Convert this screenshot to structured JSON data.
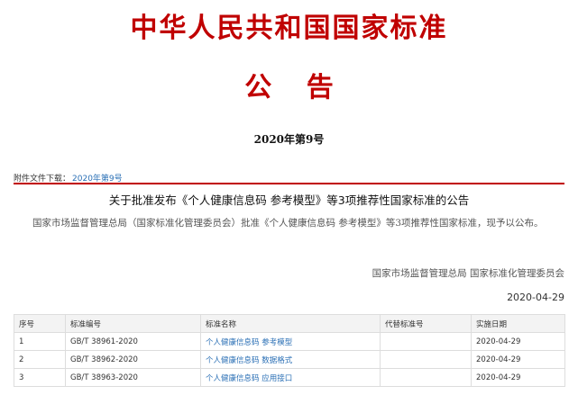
{
  "header": {
    "title": "中华人民共和国国家标准",
    "subtitle": "公 告",
    "doc_number": "2020年第9号"
  },
  "attachment": {
    "label": "附件文件下载：",
    "link_text": "2020年第9号"
  },
  "notice": {
    "title": "关于批准发布《个人健康信息码 参考模型》等3项推荐性国家标准的公告",
    "body": "国家市场监督管理总局（国家标准化管理委员会）批准《个人健康信息码 参考模型》等3项推荐性国家标准，现予以公布。",
    "issuer": "国家市场监督管理总局 国家标准化管理委员会",
    "date": "2020-04-29"
  },
  "table": {
    "headers": {
      "seq": "序号",
      "code": "标准编号",
      "name": "标准名称",
      "replaced": "代替标准号",
      "effective": "实施日期"
    },
    "rows": [
      {
        "seq": "1",
        "code": "GB/T 38961-2020",
        "name": "个人健康信息码 参考模型",
        "replaced": "",
        "effective": "2020-04-29"
      },
      {
        "seq": "2",
        "code": "GB/T 38962-2020",
        "name": "个人健康信息码 数据格式",
        "replaced": "",
        "effective": "2020-04-29"
      },
      {
        "seq": "3",
        "code": "GB/T 38963-2020",
        "name": "个人健康信息码 应用接口",
        "replaced": "",
        "effective": "2020-04-29"
      }
    ]
  }
}
